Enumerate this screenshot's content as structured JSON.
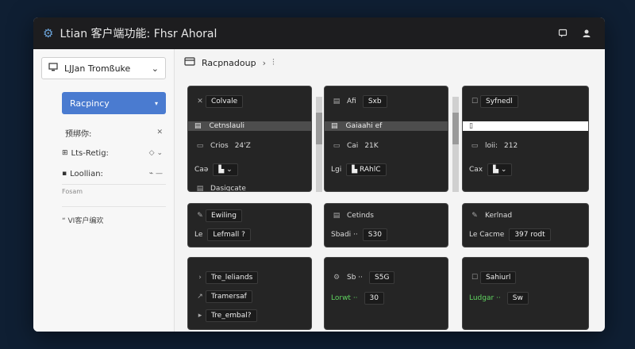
{
  "app": {
    "title": "Ltian 客户端功能: Fhsr Ahoral"
  },
  "sidebar": {
    "project_label": "LJJan Tromßuke",
    "active_label": "Racpincy",
    "items": [
      {
        "label": "预绑你:",
        "control": "✕"
      },
      {
        "label": "Lts-Retig:",
        "control": "◇  ⌄"
      },
      {
        "label": "Loollian:",
        "control": "⌁  —"
      }
    ],
    "sub_label": "Fosam",
    "section_label": "“ VI客户编欢"
  },
  "breadcrumb": {
    "label": "Racpnadoup",
    "sep1": "›",
    "sep2": "⫶"
  },
  "panels": {
    "p1": {
      "rows": [
        {
          "icon": "✕",
          "label": "Colvale"
        },
        {
          "icon": "▤",
          "label": "Cetnslauli"
        },
        {
          "icon": "▭",
          "label": "Crios",
          "value": "24'Z"
        },
        {
          "icon": "",
          "label": "Caə",
          "value": "▙  ⌄"
        },
        {
          "icon": "▤",
          "label": "Dasigcate"
        }
      ]
    },
    "p2": {
      "rows": [
        {
          "icon": "▤",
          "label": "Afi",
          "value": "Sxb"
        },
        {
          "icon": "▤",
          "label": "Gaiaahi ef"
        },
        {
          "icon": "▭",
          "label": "Cai",
          "value": "21K"
        },
        {
          "icon": "",
          "label": "Lgi",
          "value": "▙  RAhlC"
        }
      ]
    },
    "p3": {
      "rows": [
        {
          "icon": "☐",
          "label": "Syfnedl"
        },
        {
          "icon": "▯",
          "label": ""
        },
        {
          "icon": "▭",
          "label": "loii:",
          "value": "212"
        },
        {
          "icon": "",
          "label": "Cax",
          "value": "▙  ⌄"
        }
      ]
    },
    "p4": {
      "rows": [
        {
          "icon": "✎",
          "label": "Ewiling"
        },
        {
          "icon": "",
          "label": "Le",
          "value": "Lefmall ?"
        }
      ]
    },
    "p5": {
      "rows": [
        {
          "icon": "▤",
          "label": "Cetinds"
        },
        {
          "icon": "",
          "label": "Sbadi ··",
          "value": "S30"
        }
      ]
    },
    "p6": {
      "rows": [
        {
          "icon": "✎",
          "label": "Kerlnad"
        },
        {
          "icon": "",
          "label": "Le Cacme",
          "value": "397 rodt"
        }
      ]
    },
    "p7": {
      "rows": [
        {
          "icon": "›",
          "label": "Tre_leliands"
        },
        {
          "icon": "↗",
          "label": "Tramersaf"
        },
        {
          "icon": "▸",
          "label": "Tre_embal?"
        }
      ]
    },
    "p8": {
      "rows": [
        {
          "icon": "⚙",
          "label": "Sb ··",
          "value": "S5G"
        },
        {
          "icon": "",
          "label": "Lorwt ··",
          "value": "30"
        }
      ]
    },
    "p9": {
      "rows": [
        {
          "icon": "☐",
          "label": "Sahiurl"
        },
        {
          "icon": "",
          "label": "Ludgar ··",
          "value": "Sw"
        }
      ]
    }
  },
  "colors": {
    "accent": "#4a7bd0",
    "panel_bg": "#252525",
    "green": "#5fd35f"
  }
}
